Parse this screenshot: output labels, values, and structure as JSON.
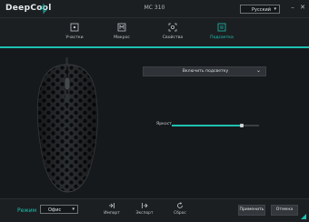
{
  "app": {
    "logo_text": "DeepCool",
    "device_name": "MC 310",
    "language": "Русский",
    "window_controls": [
      "minimize-icon",
      "close-icon"
    ]
  },
  "nav": {
    "items": [
      {
        "label": "Участки",
        "icon": "keyboard-icon"
      },
      {
        "label": "Макрос",
        "icon": "macro-icon"
      },
      {
        "label": "Свойства",
        "icon": "settings-icon"
      },
      {
        "label": "Подсветка",
        "icon": "lighting-icon"
      }
    ],
    "active_index": 3
  },
  "lighting": {
    "mode": "Включить подсветку",
    "brightness_label": "Яркост",
    "brightness_value": 0.8
  },
  "bottom": {
    "mode_label": "Режим",
    "profile": "Офис",
    "tools": [
      {
        "label": "Импорт",
        "icon": "import-icon"
      },
      {
        "label": "Экспорт",
        "icon": "export-icon"
      },
      {
        "label": "Сброс",
        "icon": "reset-icon"
      }
    ],
    "apply_label": "Применить",
    "cancel_label": "Отмена"
  },
  "colors": {
    "accent": "#1ec0b0",
    "background": "#16191c",
    "bar": "#1c1f22"
  }
}
